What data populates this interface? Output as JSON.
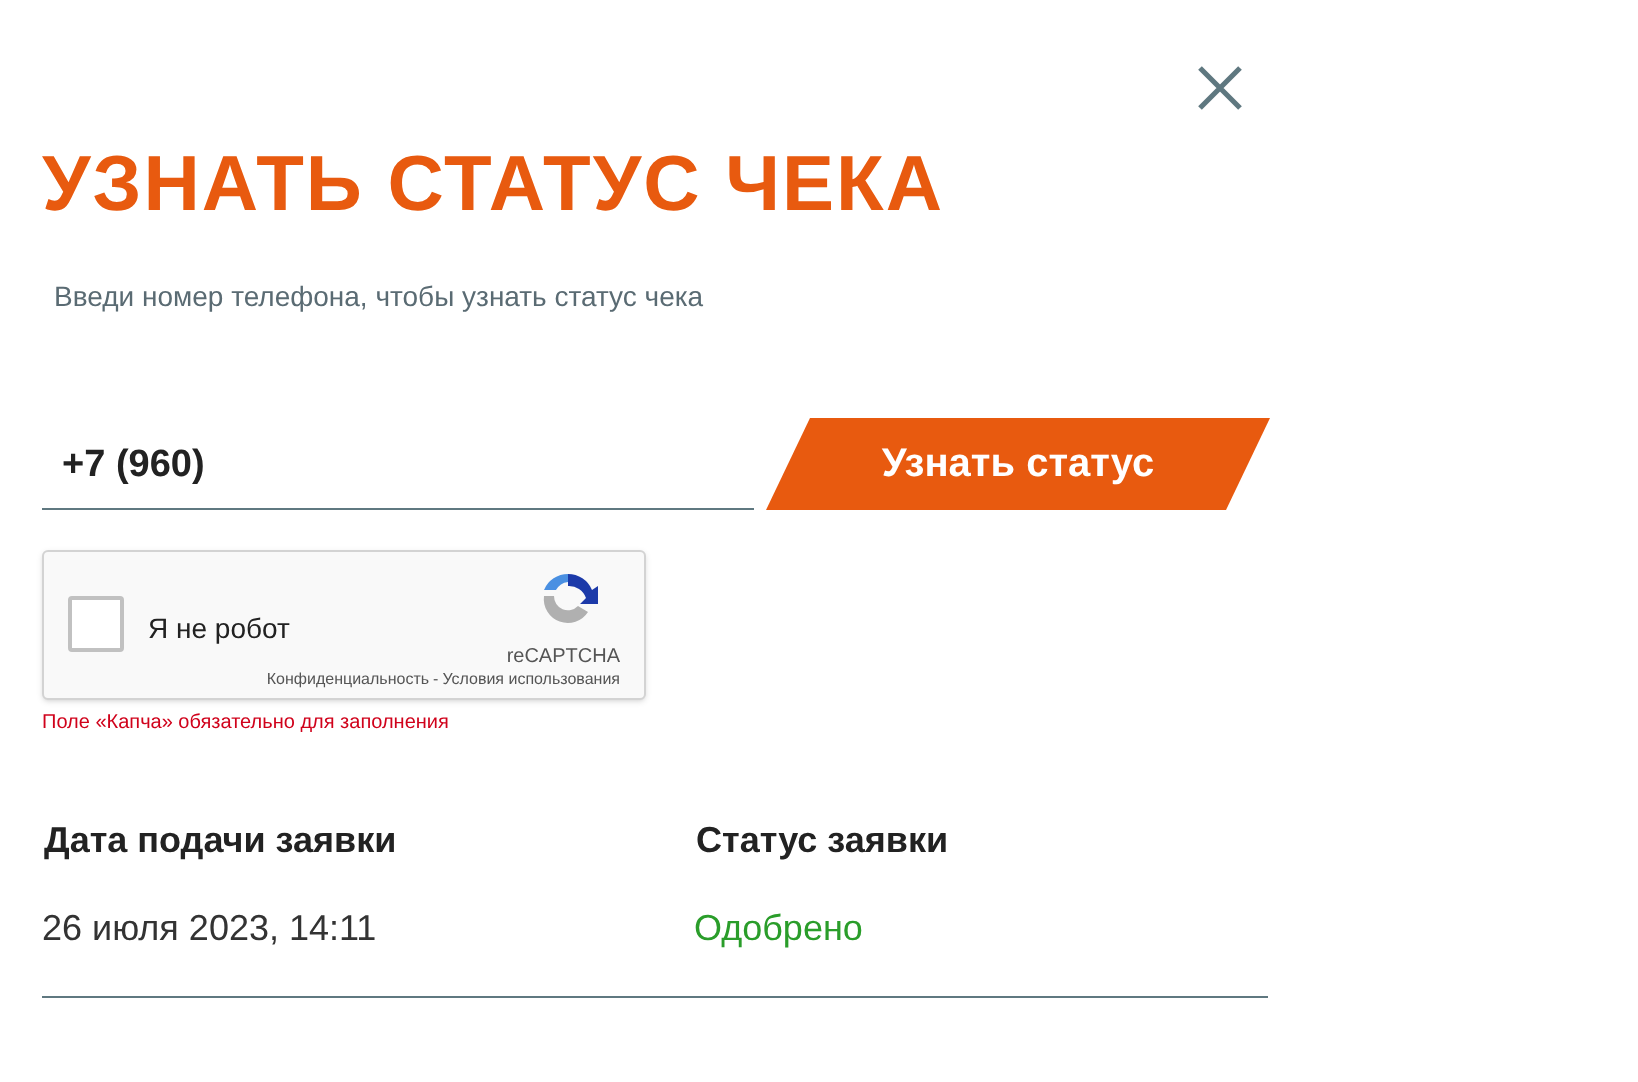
{
  "title": "УЗНАТЬ СТАТУС ЧЕКА",
  "subtitle": "Введи номер телефона, чтобы узнать статус чека",
  "phone": {
    "value": "+7 (960)"
  },
  "submit_button": "Узнать статус",
  "captcha": {
    "checked": false,
    "label": "Я не робот",
    "brand": "reCAPTCHA",
    "links": [
      "Конфиденциальность",
      "Условия использования"
    ],
    "separator": "-"
  },
  "error": "Поле «Капча» обязательно для заполнения",
  "table": {
    "columns": [
      "Дата подачи заявки",
      "Статус заявки"
    ],
    "rows": [
      {
        "cells": [
          "26 июля 2023, 14:11",
          "Одобрено"
        ]
      }
    ]
  }
}
